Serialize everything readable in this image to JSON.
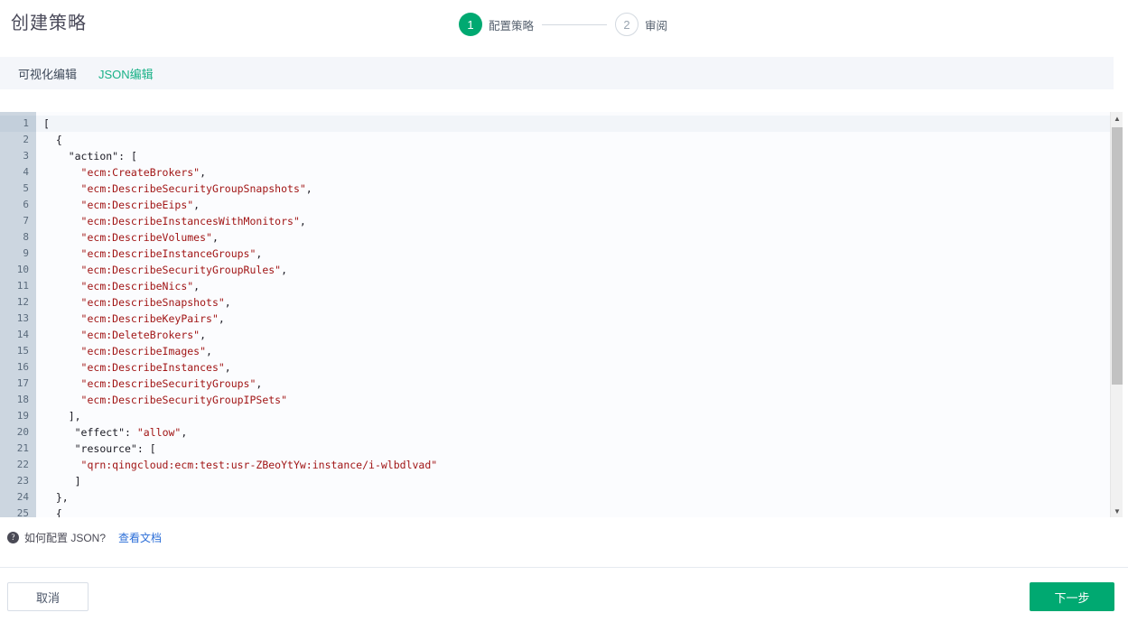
{
  "header": {
    "title": "创建策略",
    "steps": [
      {
        "number": "1",
        "label": "配置策略",
        "state": "active"
      },
      {
        "number": "2",
        "label": "审阅",
        "state": "inactive"
      }
    ]
  },
  "tabs": [
    {
      "label": "可视化编辑",
      "active": false
    },
    {
      "label": "JSON编辑",
      "active": true
    }
  ],
  "editor": {
    "active_line": 1,
    "lines": [
      {
        "n": "1",
        "indent": 0,
        "text": "["
      },
      {
        "n": "2",
        "indent": 2,
        "text": "{"
      },
      {
        "n": "3",
        "indent": 4,
        "text": "\"action\": ["
      },
      {
        "n": "4",
        "indent": 6,
        "text": "\"ecm:CreateBrokers\","
      },
      {
        "n": "5",
        "indent": 6,
        "text": "\"ecm:DescribeSecurityGroupSnapshots\","
      },
      {
        "n": "6",
        "indent": 6,
        "text": "\"ecm:DescribeEips\","
      },
      {
        "n": "7",
        "indent": 6,
        "text": "\"ecm:DescribeInstancesWithMonitors\","
      },
      {
        "n": "8",
        "indent": 6,
        "text": "\"ecm:DescribeVolumes\","
      },
      {
        "n": "9",
        "indent": 6,
        "text": "\"ecm:DescribeInstanceGroups\","
      },
      {
        "n": "10",
        "indent": 6,
        "text": "\"ecm:DescribeSecurityGroupRules\","
      },
      {
        "n": "11",
        "indent": 6,
        "text": "\"ecm:DescribeNics\","
      },
      {
        "n": "12",
        "indent": 6,
        "text": "\"ecm:DescribeSnapshots\","
      },
      {
        "n": "13",
        "indent": 6,
        "text": "\"ecm:DescribeKeyPairs\","
      },
      {
        "n": "14",
        "indent": 6,
        "text": "\"ecm:DeleteBrokers\","
      },
      {
        "n": "15",
        "indent": 6,
        "text": "\"ecm:DescribeImages\","
      },
      {
        "n": "16",
        "indent": 6,
        "text": "\"ecm:DescribeInstances\","
      },
      {
        "n": "17",
        "indent": 6,
        "text": "\"ecm:DescribeSecurityGroups\","
      },
      {
        "n": "18",
        "indent": 6,
        "text": "\"ecm:DescribeSecurityGroupIPSets\""
      },
      {
        "n": "19",
        "indent": 4,
        "text": "],"
      },
      {
        "n": "20",
        "indent": 5,
        "text": "\"effect\": \"allow\","
      },
      {
        "n": "21",
        "indent": 5,
        "text": "\"resource\": ["
      },
      {
        "n": "22",
        "indent": 6,
        "text": "\"qrn:qingcloud:ecm:test:usr-ZBeoYtYw:instance/i-wlbdlvad\""
      },
      {
        "n": "23",
        "indent": 5,
        "text": "]"
      },
      {
        "n": "24",
        "indent": 2,
        "text": "},"
      },
      {
        "n": "25",
        "indent": 2,
        "text": "{"
      }
    ]
  },
  "help": {
    "icon": "question-mark-icon",
    "text": "如何配置 JSON?",
    "link": "查看文档"
  },
  "footer": {
    "cancel_label": "取消",
    "next_label": "下一步"
  },
  "colors": {
    "accent_green": "#00a971",
    "tab_active_green": "#19b187",
    "link_blue": "#2d6fd8",
    "string_red": "#a11515",
    "gutter_bg": "#ccd6e0"
  }
}
